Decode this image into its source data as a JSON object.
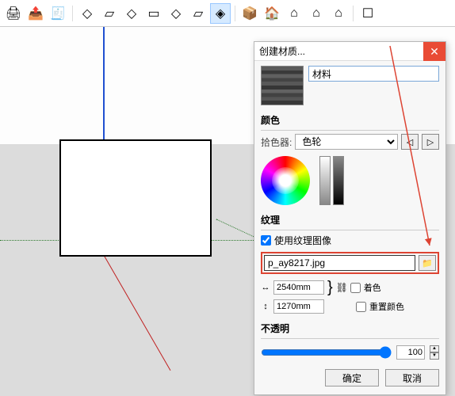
{
  "toolbar": {
    "items": [
      {
        "name": "print-icon",
        "glyph": "🖨"
      },
      {
        "name": "export-icon",
        "glyph": "📤"
      },
      {
        "name": "model-info-icon",
        "glyph": "🛈"
      }
    ],
    "shape_items": [
      {
        "name": "shape-1",
        "glyph": "◇"
      },
      {
        "name": "shape-2",
        "glyph": "▱"
      },
      {
        "name": "shape-3",
        "glyph": "◇"
      },
      {
        "name": "shape-4",
        "glyph": "▭"
      },
      {
        "name": "shape-5",
        "glyph": "◇"
      },
      {
        "name": "shape-6",
        "glyph": "▱"
      },
      {
        "name": "shape-7",
        "glyph": "◈",
        "active": true
      }
    ],
    "house_items": [
      {
        "name": "house-1",
        "glyph": "⌂"
      },
      {
        "name": "house-2",
        "glyph": "🏠"
      },
      {
        "name": "house-3",
        "glyph": "⌂"
      },
      {
        "name": "house-4",
        "glyph": "⌂"
      },
      {
        "name": "house-5",
        "glyph": "⌂"
      }
    ],
    "end_items": [
      {
        "name": "box-icon",
        "glyph": "☐"
      }
    ]
  },
  "dialog": {
    "title": "创建材质...",
    "material_name": "材料",
    "color_section": "颜色",
    "picker_label": "拾色器:",
    "picker_value": "色轮",
    "texture_section": "纹理",
    "use_texture_label": "使用纹理图像",
    "use_texture_checked": true,
    "texture_file": "p_ay8217.jpg",
    "width_value": "2540mm",
    "height_value": "1270mm",
    "colorize_label": "着色",
    "reset_color_label": "重置颜色",
    "opacity_section": "不透明",
    "opacity_value": "100",
    "ok_label": "确定",
    "cancel_label": "取消"
  }
}
